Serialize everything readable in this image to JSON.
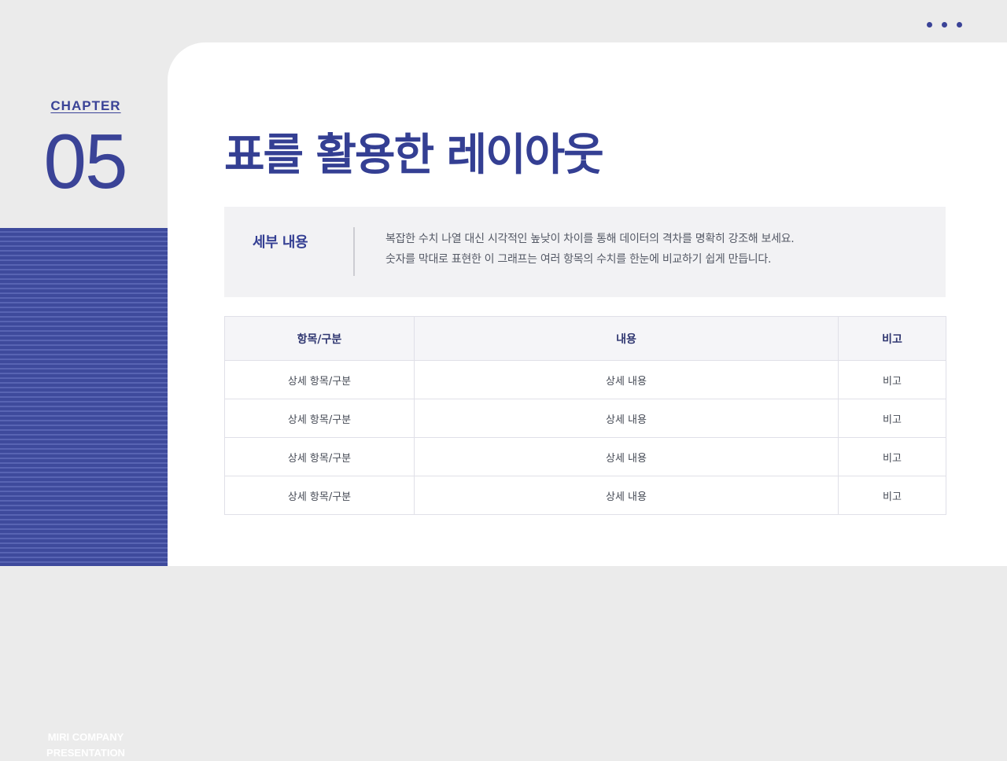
{
  "sidebar": {
    "chapter_label": "CHAPTER",
    "chapter_number": "05",
    "company_line1": "MIRI COMPANY",
    "company_line2": "PRESENTATION"
  },
  "header": {
    "more_icon": "more-horizontal-icon"
  },
  "main": {
    "title": "표를 활용한 레이아웃",
    "info": {
      "label": "세부 내용",
      "line1": "복잡한 수치 나열 대신 시각적인 높낮이 차이를 통해 데이터의 격차를 명확히 강조해 보세요.",
      "line2": "숫자를 막대로 표현한 이 그래프는 여러 항목의 수치를 한눈에 비교하기 쉽게 만듭니다."
    },
    "table": {
      "headers": [
        "항목/구분",
        "내용",
        "비고"
      ],
      "rows": [
        [
          "상세 항목/구분",
          "상세 내용",
          "비고"
        ],
        [
          "상세 항목/구분",
          "상세 내용",
          "비고"
        ],
        [
          "상세 항목/구분",
          "상세 내용",
          "비고"
        ],
        [
          "상세 항목/구분",
          "상세 내용",
          "비고"
        ]
      ]
    }
  },
  "colors": {
    "accent": "#3a4397",
    "stripe_dark": "#3e4a9c",
    "stripe_light": "#5864b3",
    "background": "#ebebeb",
    "card": "#ffffff"
  }
}
